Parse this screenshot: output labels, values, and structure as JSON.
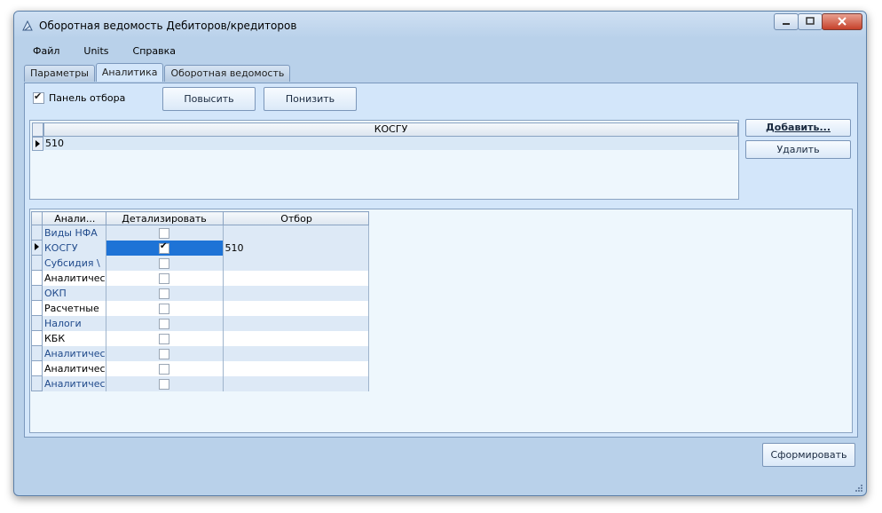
{
  "window": {
    "title": "Оборотная ведомость Дебиторов/кредиторов"
  },
  "menu": [
    "Файл",
    "Units",
    "Справка"
  ],
  "tabs": [
    {
      "label": "Параметры",
      "active": false
    },
    {
      "label": "Аналитика",
      "active": true
    },
    {
      "label": "Оборотная ведомость",
      "active": false
    }
  ],
  "filter_panel": {
    "label": "Панель отбора",
    "checked": true
  },
  "buttons": {
    "up": "Повысить",
    "down": "Понизить",
    "add": "Добавить...",
    "delete": "Удалить",
    "generate": "Сформировать"
  },
  "top_grid": {
    "header": "КОСГУ",
    "rows": [
      "510"
    ]
  },
  "analytics_grid": {
    "columns": [
      "Анали...",
      "Детализировать",
      "Отбор"
    ],
    "rows": [
      {
        "name": "Виды НФА",
        "detail": false,
        "filter": ""
      },
      {
        "name": "КОСГУ",
        "detail": true,
        "filter": "510"
      },
      {
        "name": "Субсидия \\",
        "detail": false,
        "filter": ""
      },
      {
        "name": "Аналитичес",
        "detail": false,
        "filter": ""
      },
      {
        "name": "ОКП",
        "detail": false,
        "filter": ""
      },
      {
        "name": "Расчетные",
        "detail": false,
        "filter": ""
      },
      {
        "name": "Налоги",
        "detail": false,
        "filter": ""
      },
      {
        "name": "КБК",
        "detail": false,
        "filter": ""
      },
      {
        "name": "Аналитичес",
        "detail": false,
        "filter": ""
      },
      {
        "name": "Аналитичес",
        "detail": false,
        "filter": ""
      },
      {
        "name": "Аналитичес",
        "detail": false,
        "filter": ""
      }
    ]
  },
  "colors": {
    "selection": "#1e73d6",
    "window_bg": "#b9d1ea",
    "panel_bg": "#d3e6fa"
  }
}
